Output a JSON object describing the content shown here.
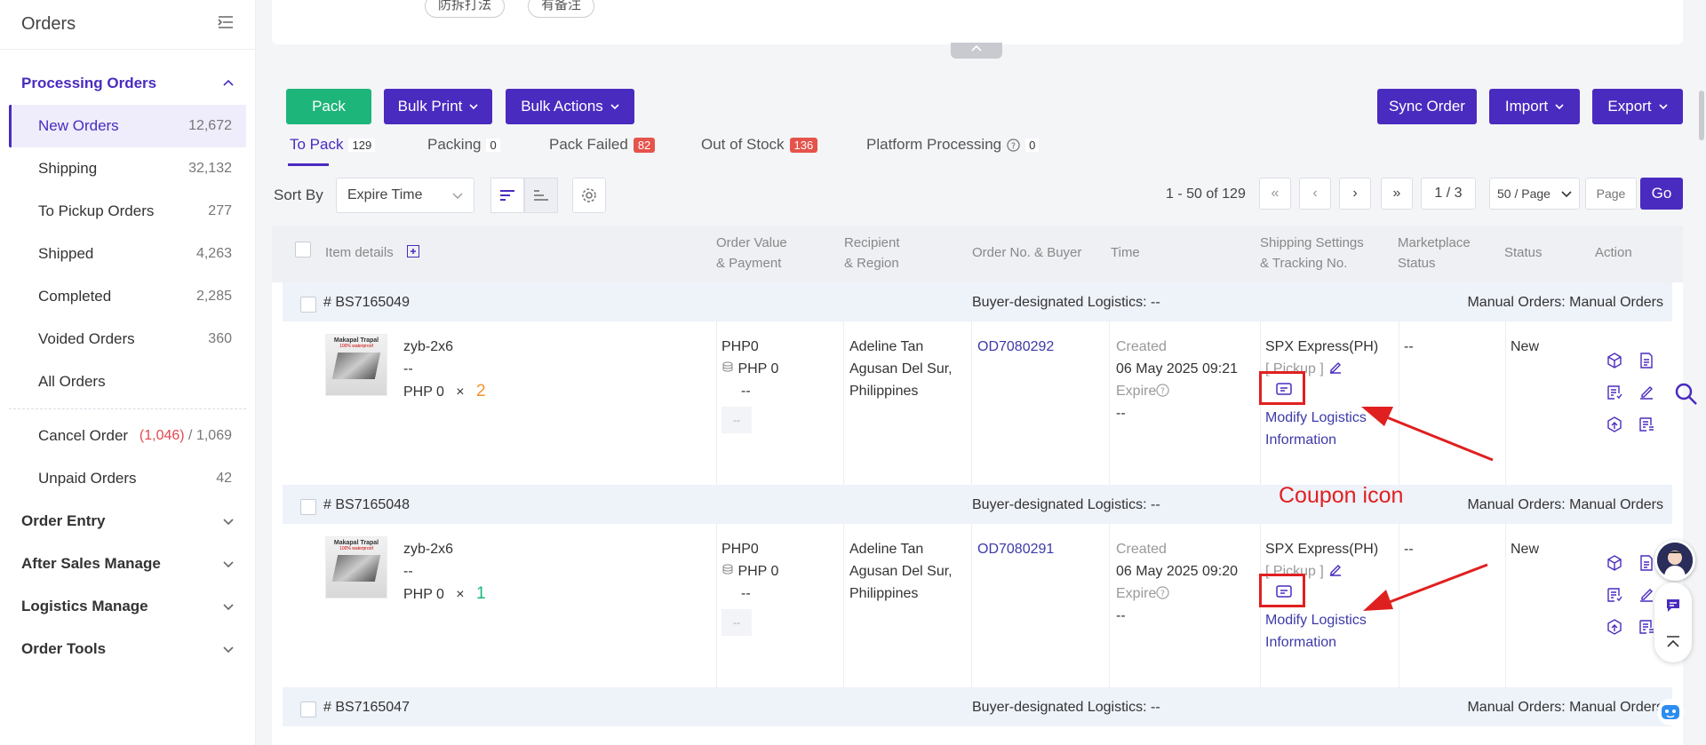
{
  "sidebar": {
    "title": "Orders",
    "processing_section": "Processing Orders",
    "items": [
      {
        "label": "New Orders",
        "count": "12,672"
      },
      {
        "label": "Shipping",
        "count": "32,132"
      },
      {
        "label": "To Pickup Orders",
        "count": "277"
      },
      {
        "label": "Shipped",
        "count": "4,263"
      },
      {
        "label": "Completed",
        "count": "2,285"
      },
      {
        "label": "Voided Orders",
        "count": "360"
      },
      {
        "label": "All Orders",
        "count": ""
      }
    ],
    "cancel": {
      "label": "Cancel Order",
      "red": "(1,046)",
      "sep": " / ",
      "total": "1,069"
    },
    "unpaid": {
      "label": "Unpaid Orders",
      "count": "42"
    },
    "sections": [
      "Order Entry",
      "After Sales Manage",
      "Logistics Manage",
      "Order Tools"
    ]
  },
  "top": {
    "pills": [
      "防拆打法",
      "有备注"
    ]
  },
  "toolbar": {
    "pack": "Pack",
    "bulk_print": "Bulk Print",
    "bulk_actions": "Bulk Actions",
    "sync": "Sync Order",
    "import": "Import",
    "export": "Export"
  },
  "tabs": [
    {
      "label": "To Pack",
      "count": "129"
    },
    {
      "label": "Packing",
      "count": "0"
    },
    {
      "label": "Pack Failed",
      "count": "82"
    },
    {
      "label": "Out of Stock",
      "count": "136"
    },
    {
      "label": "Platform Processing",
      "count": "0"
    }
  ],
  "sort": {
    "label": "Sort By",
    "value": "Expire Time"
  },
  "pager": {
    "range": "1 - 50 of 129",
    "page": "1 / 3",
    "per_page": "50 / Page",
    "page_placeholder": "Page",
    "go": "Go"
  },
  "table_headers": {
    "item": "Item details",
    "order_value_1": "Order Value",
    "order_value_2": "& Payment",
    "recipient_1": "Recipient",
    "recipient_2": "& Region",
    "order_no": "Order No. & Buyer",
    "time": "Time",
    "shipping_1": "Shipping Settings",
    "shipping_2": "& Tracking No.",
    "marketplace_1": "Marketplace",
    "marketplace_2": "Status",
    "status": "Status",
    "action": "Action"
  },
  "orders": [
    {
      "id": "# BS7165049",
      "logistics": "Buyer-designated Logistics: --",
      "manual": "Manual Orders: Manual Orders",
      "product": "zyb-2x6",
      "variant": "--",
      "price": "PHP 0",
      "times": "×",
      "qty": "2",
      "value": "PHP0",
      "payment": "PHP 0",
      "payment_extra": "--",
      "box": "--",
      "recipient_name": "Adeline Tan",
      "recipient_region": "Agusan Del Sur,",
      "recipient_country": "Philippines",
      "order_no": "OD7080292",
      "created_label": "Created",
      "created": "06 May 2025 09:21",
      "expire_label": "Expire",
      "expire": "--",
      "carrier": "SPX Express(PH)",
      "pickup": "[ Pickup ]",
      "modify_1": "Modify Logistics",
      "modify_2": "Information",
      "market_status": "--",
      "status": "New"
    },
    {
      "id": "# BS7165048",
      "logistics": "Buyer-designated Logistics: --",
      "manual": "Manual Orders: Manual Orders",
      "product": "zyb-2x6",
      "variant": "--",
      "price": "PHP 0",
      "times": "×",
      "qty": "1",
      "value": "PHP0",
      "payment": "PHP 0",
      "payment_extra": "--",
      "box": "--",
      "recipient_name": "Adeline Tan",
      "recipient_region": "Agusan Del Sur,",
      "recipient_country": "Philippines",
      "order_no": "OD7080291",
      "created_label": "Created",
      "created": "06 May 2025 09:20",
      "expire_label": "Expire",
      "expire": "--",
      "carrier": "SPX Express(PH)",
      "pickup": "[ Pickup ]",
      "modify_1": "Modify Logistics",
      "modify_2": "Information",
      "market_status": "--",
      "status": "New"
    },
    {
      "id": "# BS7165047",
      "logistics": "Buyer-designated Logistics: --",
      "manual": "Manual Orders: Manual Orders"
    }
  ],
  "annotation": "Coupon icon",
  "thumb_text": {
    "line1": "Makapal Trapal",
    "line2": "100% waterproof"
  },
  "colors": {
    "brand": "#4a2bbf",
    "green": "#1db57a",
    "red_badge": "#e5534b",
    "annotation": "#e02020"
  }
}
